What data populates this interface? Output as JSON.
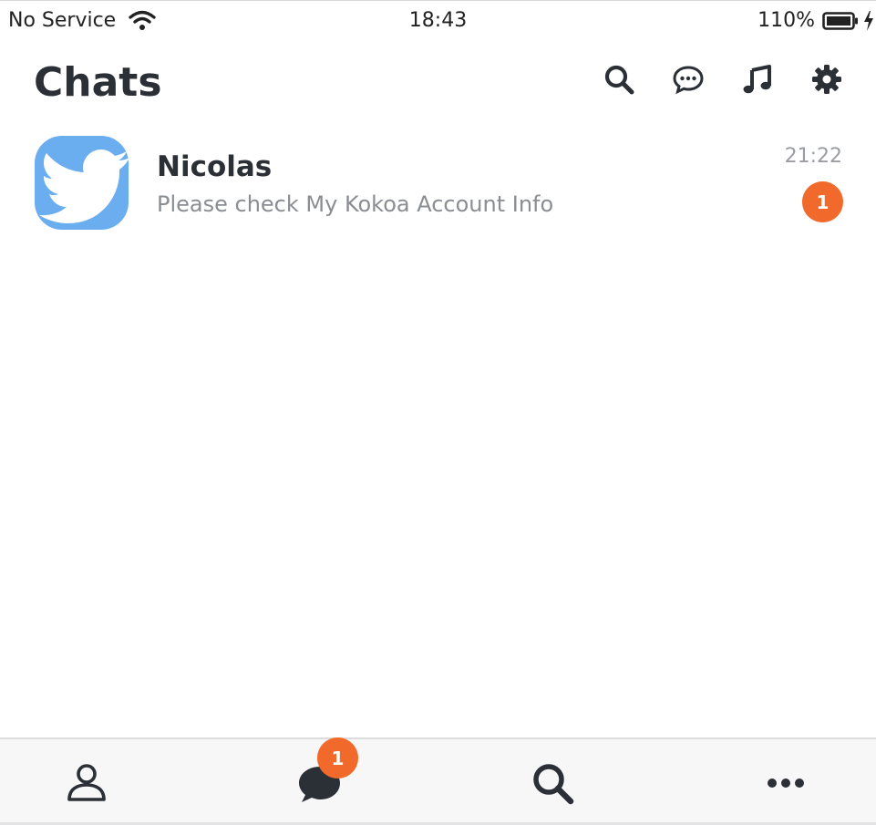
{
  "status_bar": {
    "carrier": "No Service",
    "time": "18:43",
    "battery": "110%"
  },
  "header": {
    "title": "Chats",
    "actions": [
      "search-icon",
      "chat-bubble-icon",
      "music-note-icon",
      "gear-icon"
    ]
  },
  "chats": [
    {
      "name": "Nicolas",
      "preview": "Please check My Kokoa Account Info",
      "time": "21:22",
      "unread": "1",
      "avatar_icon": "twitter-bird-icon"
    }
  ],
  "tab_bar": {
    "chats_badge": "1",
    "tabs": [
      "person-icon",
      "chat-bubble-icon",
      "search-icon",
      "more-icon"
    ]
  },
  "colors": {
    "accent": "#f26a2b",
    "avatar_bg": "#6aaef0",
    "text_primary": "#2b2f36",
    "text_secondary": "#8a8d92"
  }
}
